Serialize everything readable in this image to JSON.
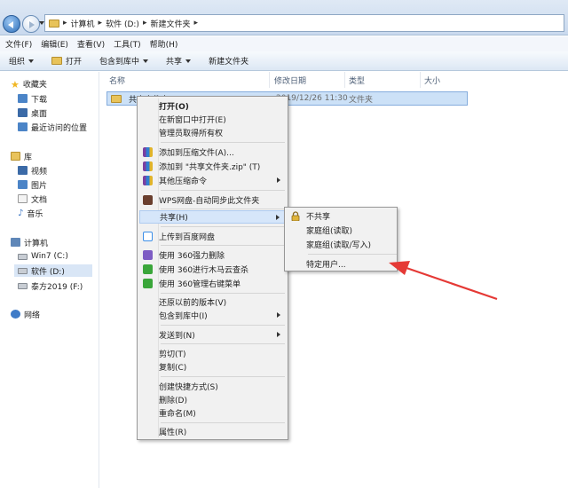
{
  "address": {
    "crumbs": [
      "计算机",
      "软件 (D:)",
      "新建文件夹"
    ],
    "separator": "▸"
  },
  "menubar": [
    "文件(F)",
    "编辑(E)",
    "查看(V)",
    "工具(T)",
    "帮助(H)"
  ],
  "toolbar": {
    "organize": "组织",
    "open": "打开",
    "include": "包含到库中",
    "share": "共享",
    "new_folder": "新建文件夹"
  },
  "sidebar": {
    "favorites": "收藏夹",
    "downloads": "下载",
    "desktop": "桌面",
    "recent": "最近访问的位置",
    "libraries": "库",
    "video": "视频",
    "pictures": "图片",
    "documents": "文档",
    "music": "音乐",
    "computer": "计算机",
    "drive_c": "Win7 (C:)",
    "drive_d": "软件 (D:)",
    "drive_f": "泰方2019 (F:)",
    "network": "网络"
  },
  "columns": {
    "name": "名称",
    "date": "修改日期",
    "type": "类型",
    "size": "大小"
  },
  "file": {
    "name": "共享文件夹",
    "date": "2019/12/26 11:30",
    "type": "文件夹"
  },
  "context_menu": {
    "open": "打开(O)",
    "open_new_window": "在新窗口中打开(E)",
    "admin_ownership": "管理员取得所有权",
    "add_archive": "添加到压缩文件(A)...",
    "add_zip": "添加到 \"共享文件夹.zip\" (T)",
    "other_compress": "其他压缩命令",
    "wps": "WPS网盘-自动同步此文件夹",
    "share": "共享(H)",
    "baidu": "上传到百度网盘",
    "force_delete_360": "使用 360强力删除",
    "trojan_scan_360": "使用 360进行木马云查杀",
    "manage_menu_360": "使用 360管理右键菜单",
    "restore": "还原以前的版本(V)",
    "include_library": "包含到库中(I)",
    "send_to": "发送到(N)",
    "cut": "剪切(T)",
    "copy": "复制(C)",
    "create_shortcut": "创建快捷方式(S)",
    "delete": "删除(D)",
    "rename": "重命名(M)",
    "properties": "属性(R)"
  },
  "share_submenu": {
    "no_share": "不共享",
    "homegroup_read": "家庭组(读取)",
    "homegroup_readwrite": "家庭组(读取/写入)",
    "specific_people": "特定用户..."
  },
  "colors": {
    "selection": "#cce1f7",
    "menu_highlight": "#d6e6fa",
    "annotation_arrow": "#e53935"
  }
}
